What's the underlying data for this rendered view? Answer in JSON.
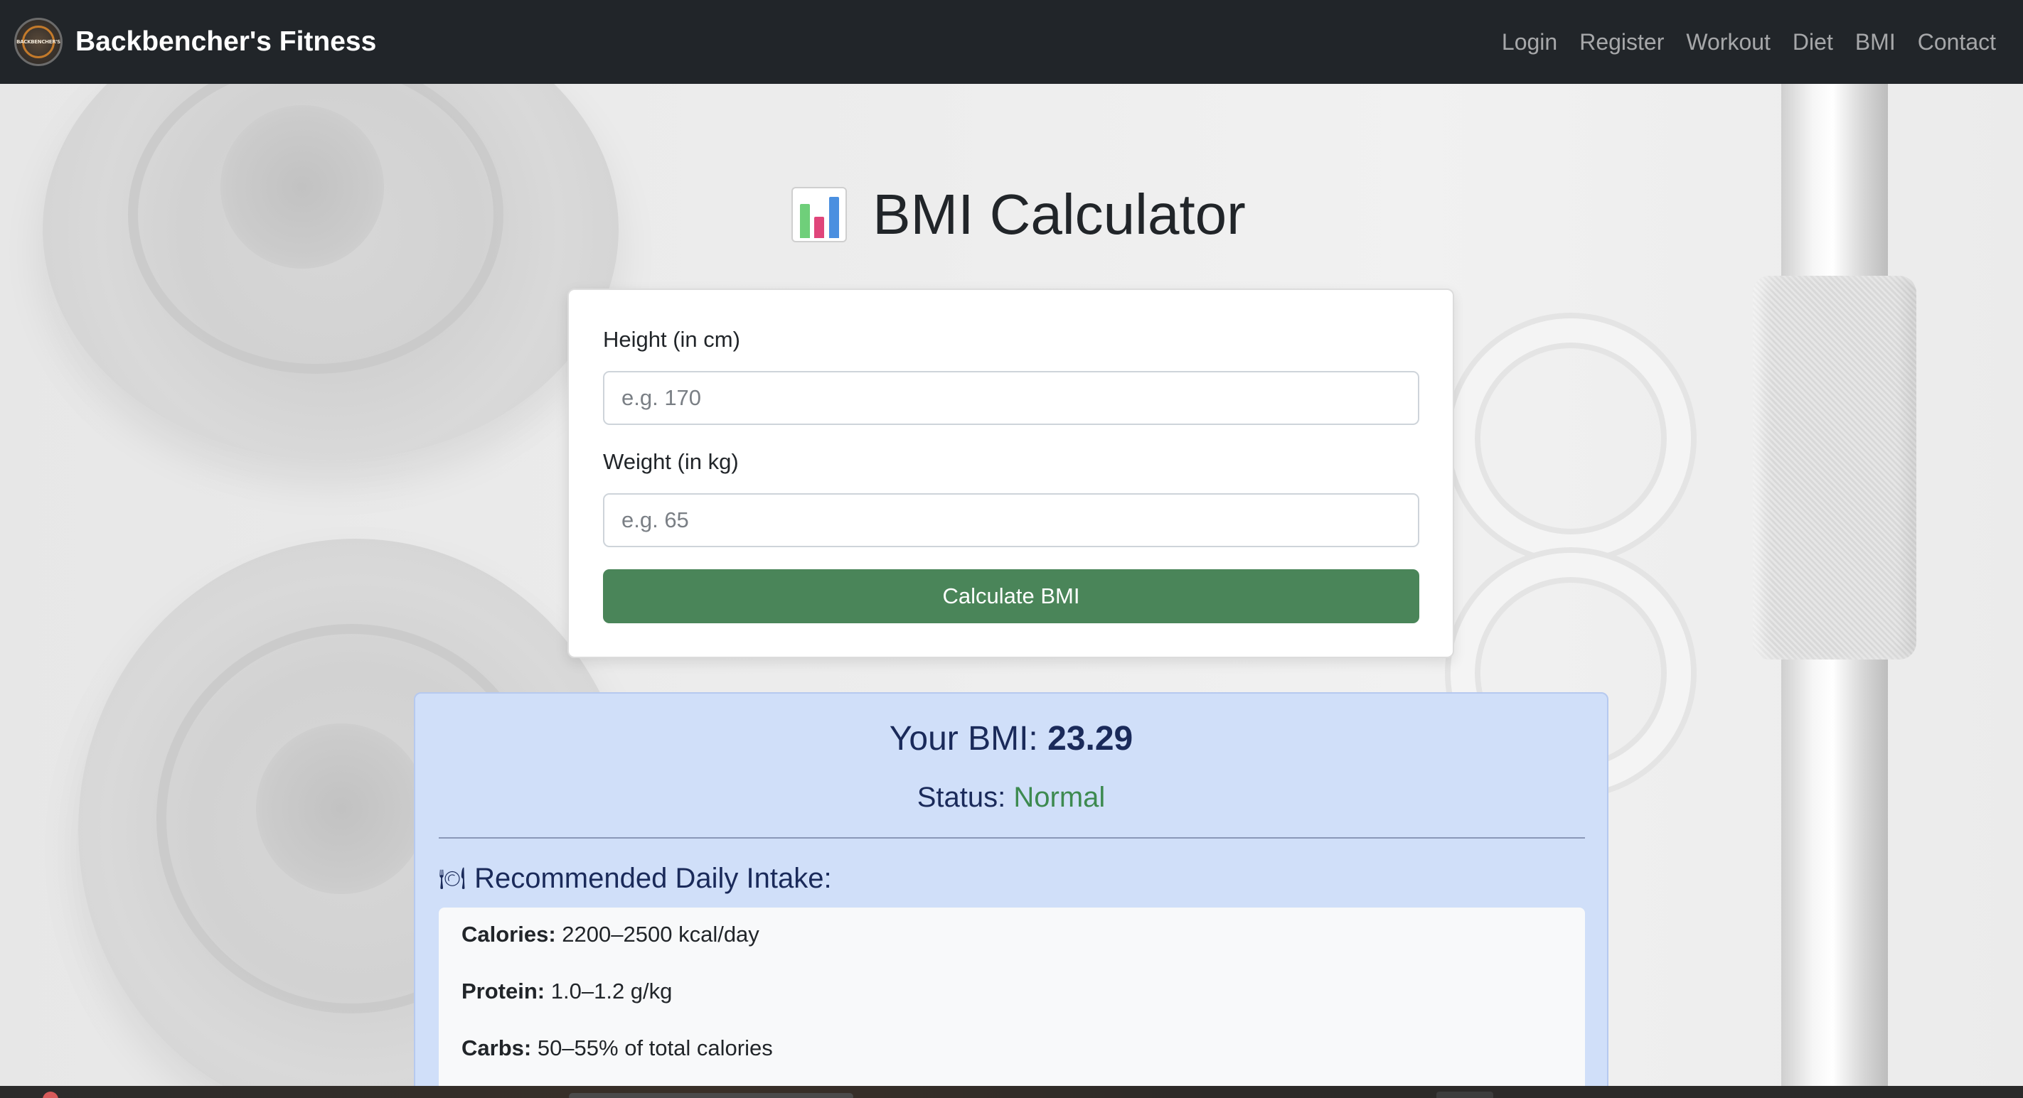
{
  "navbar": {
    "brand": "Backbencher's Fitness",
    "logo_text": "BACKBENCHER'S",
    "links": [
      "Login",
      "Register",
      "Workout",
      "Diet",
      "BMI",
      "Contact"
    ]
  },
  "title": {
    "icon": "bar-chart-icon",
    "text": "BMI Calculator"
  },
  "form": {
    "height_label": "Height (in cm)",
    "height_placeholder": "e.g. 170",
    "weight_label": "Weight (in kg)",
    "weight_placeholder": "e.g. 65",
    "submit_label": "Calculate BMI"
  },
  "result": {
    "bmi_prefix": "Your BMI:",
    "bmi_value": "23.29",
    "status_prefix": "Status:",
    "status_value": "Normal",
    "intake_icon": "plate-cutlery-icon",
    "intake_heading": "Recommended Daily Intake:",
    "intake": [
      {
        "label": "Calories:",
        "value": "2200–2500 kcal/day"
      },
      {
        "label": "Protein:",
        "value": "1.0–1.2 g/kg"
      },
      {
        "label": "Carbs:",
        "value": "50–55% of total calories"
      }
    ]
  },
  "colors": {
    "navbar_bg": "#212529",
    "button_bg": "#4a8559",
    "result_bg": "#d0dff9",
    "status_normal": "#3d8a50"
  }
}
